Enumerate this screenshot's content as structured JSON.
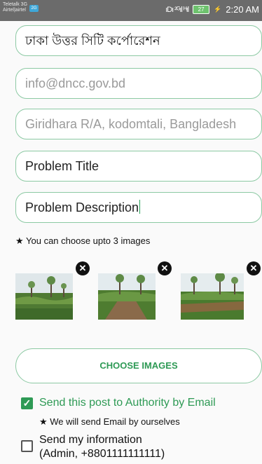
{
  "statusbar": {
    "carrier_line1": "Teletalk 3G",
    "carrier_line2": "Airtel|airtel",
    "network_badge": "2G",
    "signal_text": "ıDı ²ᴳıl ᴴıl",
    "battery": "27",
    "time": "2:20 AM"
  },
  "form": {
    "authority_name": "ঢাকা উত্তর সিটি কর্পোরেশন",
    "email_value": "info@dncc.gov.bd",
    "address_value": "Giridhara R/A, kodomtali, Bangladesh",
    "title_placeholder": "Problem Title",
    "description_value": "Problem Description"
  },
  "images": {
    "hint": "★ You can choose upto 3 images",
    "remove_glyph": "✕",
    "items": [
      "tea-garden-photo-1",
      "tea-garden-photo-2",
      "tea-garden-photo-3"
    ]
  },
  "choose_button": {
    "label": "CHOOSE IMAGES"
  },
  "options": {
    "send_email": {
      "label": "Send this post to Authority by Email",
      "checked": true
    },
    "email_note": "★ We will send Email by ourselves",
    "send_info": {
      "label_line1": "Send my information",
      "label_line2": "(Admin, +8801111111111)",
      "checked": false
    }
  },
  "colors": {
    "accent": "#2e9a55",
    "border": "#8cc9a3",
    "statusbar": "#6b6b6b"
  }
}
